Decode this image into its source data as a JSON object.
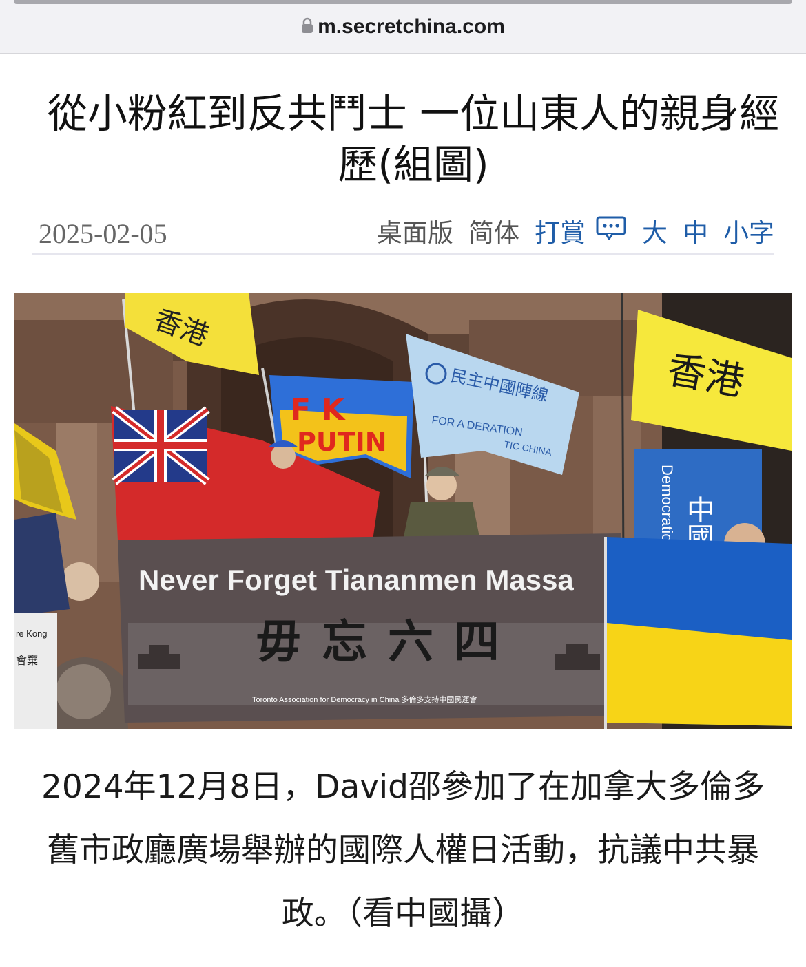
{
  "browser": {
    "url": "m.secretchina.com"
  },
  "article": {
    "title": "從小粉紅到反共鬥士 一位山東人的親身經歷(組圖)",
    "date": "2025-02-05",
    "tools": {
      "desktop": "桌面版",
      "simplified": "简体",
      "tip": "打賞",
      "size_large": "大",
      "size_medium": "中",
      "size_small": "小字"
    },
    "photo": {
      "banner_text": "Never Forget Tiananmen Massa",
      "banner_chinese": "毋忘六四",
      "banner_footer": "Toronto Association for Democracy in China 多倫多支持中國民運會",
      "flag_hk_left": "香港",
      "flag_hk_right": "香港",
      "flag_democracy_cn": "民主中國陣線",
      "flag_democracy_en": "FOR A DERATION",
      "flag_democracy_en2": "TIC CHINA",
      "blue_banner_cn": "中國",
      "blue_banner_en": "Democratic",
      "sign_text": "re Kong",
      "sign_cn": "會棄"
    },
    "caption": "2024年12月8日，David邵參加了在加拿大多倫多舊市政廳廣場舉辦的國際人權日活動，抗議中共暴政。（看中國攝）"
  },
  "colors": {
    "link_blue": "#1f5da8",
    "hk_yellow": "#f4e03a",
    "ukraine_blue": "#1b5fc4",
    "ukraine_yellow": "#f7d417"
  }
}
